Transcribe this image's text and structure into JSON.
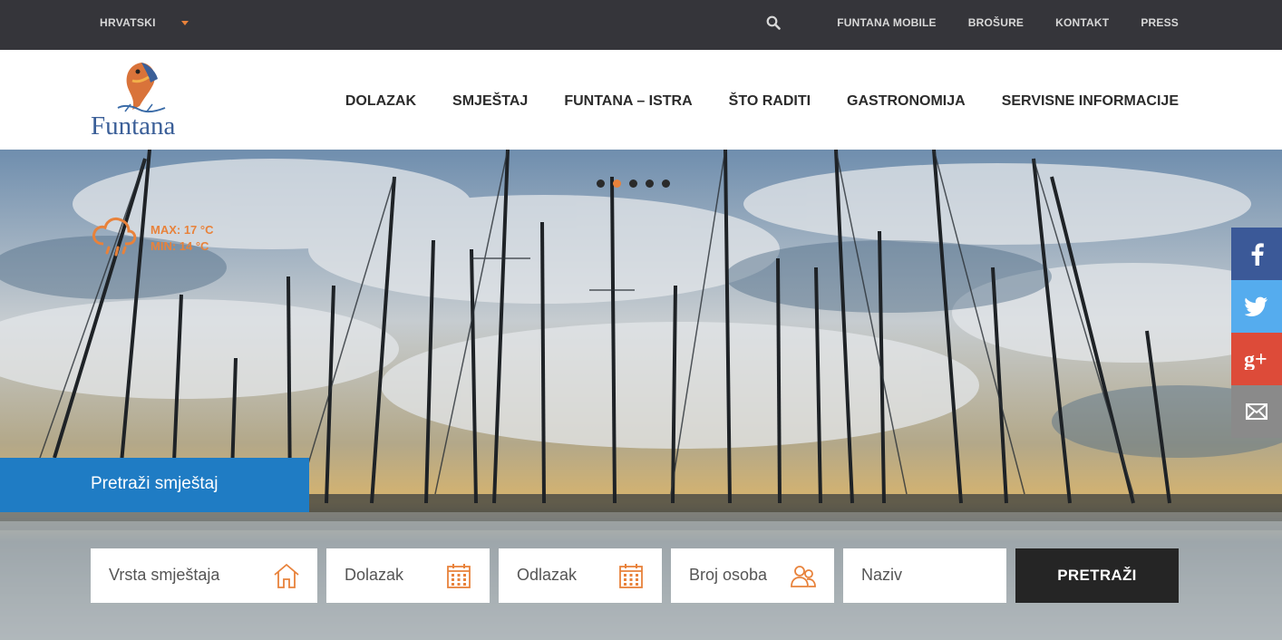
{
  "topbar": {
    "language": "HRVATSKI",
    "links": [
      "FUNTANA MOBILE",
      "BROŠURE",
      "KONTAKT",
      "PRESS"
    ]
  },
  "header": {
    "logo_text": "Funtana",
    "nav": [
      "DOLAZAK",
      "SMJEŠTAJ",
      "FUNTANA – ISTRA",
      "ŠTO RADITI",
      "GASTRONOMIJA",
      "SERVISNE INFORMACIJE"
    ]
  },
  "hero": {
    "slider_dots": 5,
    "active_dot": 2,
    "weather": {
      "max": "MAX: 17 °C",
      "min": "MIN: 14 °C",
      "icon": "rain-cloud-icon"
    }
  },
  "social": [
    "facebook-icon",
    "twitter-icon",
    "google-plus-icon",
    "mail-icon"
  ],
  "search": {
    "tab_label": "Pretraži smještaj",
    "fields": {
      "type": "Vrsta smještaja",
      "arrival": "Dolazak",
      "departure": "Odlazak",
      "persons": "Broj osoba",
      "name": "Naziv"
    },
    "submit": "PRETRAŽI"
  },
  "colors": {
    "accent": "#e8823b",
    "blue": "#1f7cc4",
    "topbar": "#35353a"
  }
}
